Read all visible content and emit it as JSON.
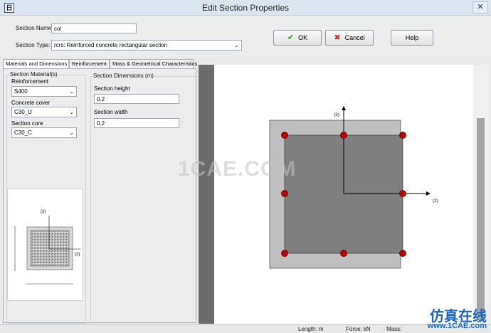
{
  "window": {
    "title": "Edit Section Properties",
    "app_icon_glyph": "日",
    "close_glyph": "✕"
  },
  "header": {
    "section_name_label": "Section Name:",
    "section_name_value": "col",
    "section_type_label": "Section Type:",
    "section_type_value": "rcrs: Reinforced concrete rectangular section",
    "ok_label": "OK",
    "cancel_label": "Cancel",
    "help_label": "Help"
  },
  "tabs": [
    "Materials and Dimensions",
    "Reinforcement",
    "Mass & Geometrical Characteristics"
  ],
  "materials": {
    "group_title": "Section Material(s)",
    "reinforcement_label": "Reinforcement",
    "reinforcement_value": "S400",
    "cover_label": "Concrete cover",
    "cover_value": "C30_U",
    "core_label": "Section core",
    "core_value": "C30_C"
  },
  "dimensions": {
    "group_title": "Section Dimensions (m)",
    "height_label": "Section height",
    "height_value": "0.2",
    "width_label": "Section width",
    "width_value": "0.2"
  },
  "preview": {
    "axis3": "(3)",
    "axis2": "(2)"
  },
  "view": {
    "axis3": "(3)",
    "axis2": "(2)"
  },
  "watermark": "1CAE.COM",
  "brand": {
    "text": "仿真在线",
    "url": "www.1CAE.com"
  },
  "status": {
    "length": "Length: m",
    "force": "Force: kN",
    "mass": "Mass:"
  },
  "colors": {
    "cover": "#c0c0c0",
    "core": "#7f7f7f",
    "rebar": "#c00000"
  }
}
